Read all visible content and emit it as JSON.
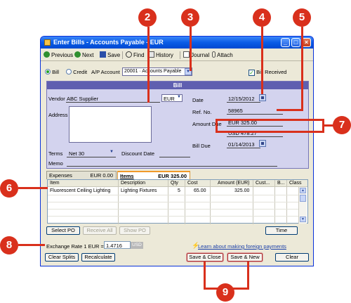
{
  "window": {
    "title": "Enter Bills - Accounts Payable - EUR",
    "controls": [
      "_",
      "□",
      "×"
    ]
  },
  "toolbar": {
    "previous": "Previous",
    "next": "Next",
    "save": "Save",
    "find": "Find",
    "history": "History",
    "journal": "Journal",
    "attach": "Attach"
  },
  "options": {
    "bill": "Bill",
    "credit": "Credit",
    "ap_account_label": "A/P Account",
    "ap_account_value": "20001 · Accounts Payable",
    "bill_received": "Bill Received"
  },
  "bill": {
    "header": "Bill",
    "vendor_label": "Vendor",
    "vendor_value": "ABC Supplier",
    "currency": "EUR",
    "address_label": "Address",
    "date_label": "Date",
    "date_value": "12/15/2012",
    "refno_label": "Ref. No.",
    "refno_value": "58965",
    "amount_due_label": "Amount Due",
    "amount_eur_cur": "EUR",
    "amount_eur": "325.00",
    "amount_usd_cur": "USD",
    "amount_usd": "478.27",
    "bill_due_label": "Bill Due",
    "bill_due_value": "01/14/2013",
    "terms_label": "Terms",
    "terms_value": "Net 30",
    "discount_date_label": "Discount Date",
    "memo_label": "Memo"
  },
  "tabs": [
    {
      "label": "Expenses",
      "amount": "EUR 0.00"
    },
    {
      "label": "Items",
      "amount": "EUR 325.00"
    }
  ],
  "items_table": {
    "columns": [
      "Item",
      "Description",
      "Qty",
      "Cost",
      "Amount (EUR)",
      "Cust...",
      "B...",
      "Class"
    ],
    "rows": [
      {
        "item": "Fluorescent Ceiling Lighting",
        "description": "Lighting Fixtures",
        "qty": "5",
        "cost": "65.00",
        "amount": "325.00",
        "cust": "",
        "b": "",
        "class": ""
      }
    ]
  },
  "item_buttons": {
    "select_po": "Select PO",
    "receive_all": "Receive All",
    "show_po": "Show PO",
    "time": "Time"
  },
  "exchange": {
    "label": "Exchange Rate 1 EUR =",
    "value": "1.4716",
    "unit": "USD",
    "learn_link": "Learn about making foreign payments"
  },
  "footer": {
    "clear_splits": "Clear Splits",
    "recalculate": "Recalculate",
    "save_close": "Save & Close",
    "save_new": "Save & New",
    "clear": "Clear"
  },
  "callouts": [
    "2",
    "3",
    "4",
    "5",
    "6",
    "7",
    "8",
    "9"
  ],
  "colors": {
    "callout": "#d9301c",
    "bill_panel": "#d3d3ee",
    "bill_header": "#5f5fb0",
    "title_bar": "#0a5ce6"
  }
}
